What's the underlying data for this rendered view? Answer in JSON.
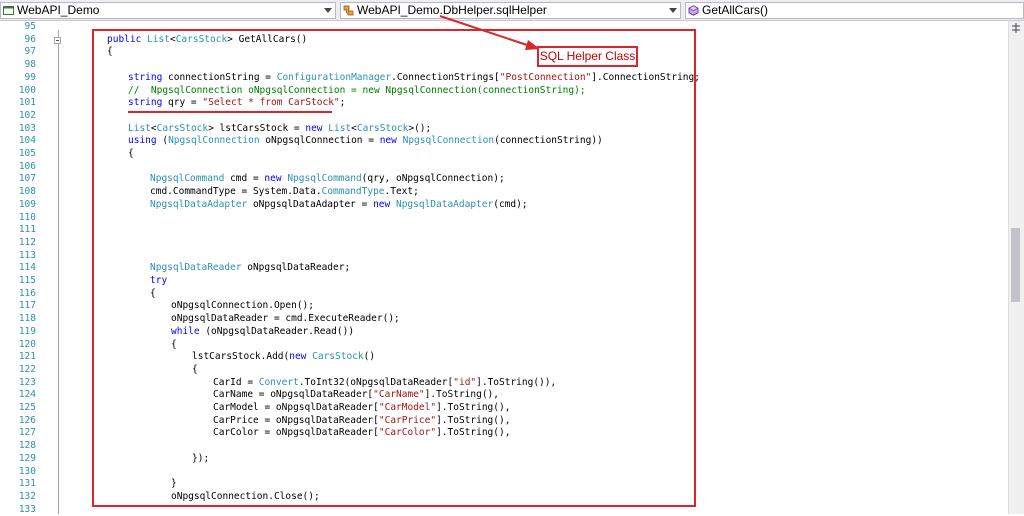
{
  "navbar": {
    "project": "WebAPI_Demo",
    "class": "WebAPI_Demo.DbHelper.sqlHelper",
    "member": "GetAllCars()"
  },
  "annotation": {
    "label": "SQL Helper Class",
    "color": "#d9262b"
  },
  "colors": {
    "keyword": "#0000ff",
    "type": "#2b91af",
    "string": "#a31515",
    "comment": "#008000",
    "line_number": "#2b91af"
  },
  "lines": [
    {
      "n": "95",
      "indent": 0,
      "tokens": []
    },
    {
      "n": "96",
      "indent": 0,
      "tokens": [
        {
          "t": "public",
          "c": "kw"
        },
        {
          "t": " ",
          "c": ""
        },
        {
          "t": "List",
          "c": "ty"
        },
        {
          "t": "<",
          "c": ""
        },
        {
          "t": "CarsStock",
          "c": "ty"
        },
        {
          "t": "> GetAllCars()",
          "c": ""
        }
      ]
    },
    {
      "n": "97",
      "indent": 0,
      "tokens": [
        {
          "t": "{",
          "c": ""
        }
      ]
    },
    {
      "n": "98",
      "indent": 0,
      "tokens": []
    },
    {
      "n": "99",
      "indent": 1,
      "tokens": [
        {
          "t": "string",
          "c": "kw"
        },
        {
          "t": " connectionString = ",
          "c": ""
        },
        {
          "t": "ConfigurationManager",
          "c": "ty"
        },
        {
          "t": ".ConnectionStrings[",
          "c": ""
        },
        {
          "t": "\"PostConnection\"",
          "c": "st"
        },
        {
          "t": "].ConnectionString;",
          "c": ""
        }
      ]
    },
    {
      "n": "100",
      "indent": 1,
      "tokens": [
        {
          "t": "//  NpgsqlConnection oNpgsqlConnection = new NpgsqlConnection(connectionString);",
          "c": "cm"
        }
      ]
    },
    {
      "n": "101",
      "indent": 1,
      "tokens": [
        {
          "t": "string",
          "c": "kw"
        },
        {
          "t": " qry = ",
          "c": ""
        },
        {
          "t": "\"Select * from CarStock\"",
          "c": "st"
        },
        {
          "t": ";",
          "c": ""
        }
      ]
    },
    {
      "n": "102",
      "indent": 0,
      "tokens": []
    },
    {
      "n": "103",
      "indent": 1,
      "tokens": [
        {
          "t": "List",
          "c": "ty"
        },
        {
          "t": "<",
          "c": ""
        },
        {
          "t": "CarsStock",
          "c": "ty"
        },
        {
          "t": "> lstCarsStock = ",
          "c": ""
        },
        {
          "t": "new",
          "c": "kw"
        },
        {
          "t": " ",
          "c": ""
        },
        {
          "t": "List",
          "c": "ty"
        },
        {
          "t": "<",
          "c": ""
        },
        {
          "t": "CarsStock",
          "c": "ty"
        },
        {
          "t": ">();",
          "c": ""
        }
      ]
    },
    {
      "n": "104",
      "indent": 1,
      "tokens": [
        {
          "t": "using",
          "c": "kw"
        },
        {
          "t": " (",
          "c": ""
        },
        {
          "t": "NpgsqlConnection",
          "c": "ty"
        },
        {
          "t": " oNpgsqlConnection = ",
          "c": ""
        },
        {
          "t": "new",
          "c": "kw"
        },
        {
          "t": " ",
          "c": ""
        },
        {
          "t": "NpgsqlConnection",
          "c": "ty"
        },
        {
          "t": "(connectionString))",
          "c": ""
        }
      ]
    },
    {
      "n": "105",
      "indent": 1,
      "tokens": [
        {
          "t": "{",
          "c": ""
        }
      ]
    },
    {
      "n": "106",
      "indent": 0,
      "tokens": []
    },
    {
      "n": "107",
      "indent": 2,
      "tokens": [
        {
          "t": "NpgsqlCommand",
          "c": "ty"
        },
        {
          "t": " cmd = ",
          "c": ""
        },
        {
          "t": "new",
          "c": "kw"
        },
        {
          "t": " ",
          "c": ""
        },
        {
          "t": "NpgsqlCommand",
          "c": "ty"
        },
        {
          "t": "(qry, oNpgsqlConnection);",
          "c": ""
        }
      ]
    },
    {
      "n": "108",
      "indent": 2,
      "tokens": [
        {
          "t": "cmd.CommandType = System.Data.",
          "c": ""
        },
        {
          "t": "CommandType",
          "c": "ty"
        },
        {
          "t": ".Text;",
          "c": ""
        }
      ]
    },
    {
      "n": "109",
      "indent": 2,
      "tokens": [
        {
          "t": "NpgsqlDataAdapter",
          "c": "ty"
        },
        {
          "t": " oNpgsqlDataAdapter = ",
          "c": ""
        },
        {
          "t": "new",
          "c": "kw"
        },
        {
          "t": " ",
          "c": ""
        },
        {
          "t": "NpgsqlDataAdapter",
          "c": "ty"
        },
        {
          "t": "(cmd);",
          "c": ""
        }
      ]
    },
    {
      "n": "110",
      "indent": 0,
      "tokens": []
    },
    {
      "n": "111",
      "indent": 0,
      "tokens": []
    },
    {
      "n": "112",
      "indent": 0,
      "tokens": []
    },
    {
      "n": "113",
      "indent": 0,
      "tokens": []
    },
    {
      "n": "114",
      "indent": 2,
      "tokens": [
        {
          "t": "NpgsqlDataReader",
          "c": "ty"
        },
        {
          "t": " oNpgsqlDataReader;",
          "c": ""
        }
      ]
    },
    {
      "n": "115",
      "indent": 2,
      "tokens": [
        {
          "t": "try",
          "c": "kw"
        }
      ]
    },
    {
      "n": "116",
      "indent": 2,
      "tokens": [
        {
          "t": "{",
          "c": ""
        }
      ]
    },
    {
      "n": "117",
      "indent": 3,
      "tokens": [
        {
          "t": "oNpgsqlConnection.Open();",
          "c": ""
        }
      ]
    },
    {
      "n": "118",
      "indent": 3,
      "tokens": [
        {
          "t": "oNpgsqlDataReader = cmd.ExecuteReader();",
          "c": ""
        }
      ]
    },
    {
      "n": "119",
      "indent": 3,
      "tokens": [
        {
          "t": "while",
          "c": "kw"
        },
        {
          "t": " (oNpgsqlDataReader.Read())",
          "c": ""
        }
      ]
    },
    {
      "n": "120",
      "indent": 3,
      "tokens": [
        {
          "t": "{",
          "c": ""
        }
      ]
    },
    {
      "n": "121",
      "indent": 4,
      "tokens": [
        {
          "t": "lstCarsStock.Add(",
          "c": ""
        },
        {
          "t": "new",
          "c": "kw"
        },
        {
          "t": " ",
          "c": ""
        },
        {
          "t": "CarsStock",
          "c": "ty"
        },
        {
          "t": "()",
          "c": ""
        }
      ]
    },
    {
      "n": "122",
      "indent": 4,
      "tokens": [
        {
          "t": "{",
          "c": ""
        }
      ]
    },
    {
      "n": "123",
      "indent": 5,
      "tokens": [
        {
          "t": "CarId = ",
          "c": ""
        },
        {
          "t": "Convert",
          "c": "ty"
        },
        {
          "t": ".ToInt32(oNpgsqlDataReader[",
          "c": ""
        },
        {
          "t": "\"id\"",
          "c": "st"
        },
        {
          "t": "].ToString()),",
          "c": ""
        }
      ]
    },
    {
      "n": "124",
      "indent": 5,
      "tokens": [
        {
          "t": "CarName = oNpgsqlDataReader[",
          "c": ""
        },
        {
          "t": "\"CarName\"",
          "c": "st"
        },
        {
          "t": "].ToString(),",
          "c": ""
        }
      ]
    },
    {
      "n": "125",
      "indent": 5,
      "tokens": [
        {
          "t": "CarModel = oNpgsqlDataReader[",
          "c": ""
        },
        {
          "t": "\"CarModel\"",
          "c": "st"
        },
        {
          "t": "].ToString(),",
          "c": ""
        }
      ]
    },
    {
      "n": "126",
      "indent": 5,
      "tokens": [
        {
          "t": "CarPrice = oNpgsqlDataReader[",
          "c": ""
        },
        {
          "t": "\"CarPrice\"",
          "c": "st"
        },
        {
          "t": "].ToString(),",
          "c": ""
        }
      ]
    },
    {
      "n": "127",
      "indent": 5,
      "tokens": [
        {
          "t": "CarColor = oNpgsqlDataReader[",
          "c": ""
        },
        {
          "t": "\"CarColor\"",
          "c": "st"
        },
        {
          "t": "].ToString(),",
          "c": ""
        }
      ]
    },
    {
      "n": "128",
      "indent": 0,
      "tokens": []
    },
    {
      "n": "129",
      "indent": 4,
      "tokens": [
        {
          "t": "});",
          "c": ""
        }
      ]
    },
    {
      "n": "130",
      "indent": 0,
      "tokens": []
    },
    {
      "n": "131",
      "indent": 3,
      "tokens": [
        {
          "t": "}",
          "c": ""
        }
      ]
    },
    {
      "n": "132",
      "indent": 3,
      "tokens": [
        {
          "t": "oNpgsqlConnection.Close();",
          "c": ""
        }
      ]
    },
    {
      "n": "133",
      "indent": 0,
      "tokens": []
    }
  ]
}
